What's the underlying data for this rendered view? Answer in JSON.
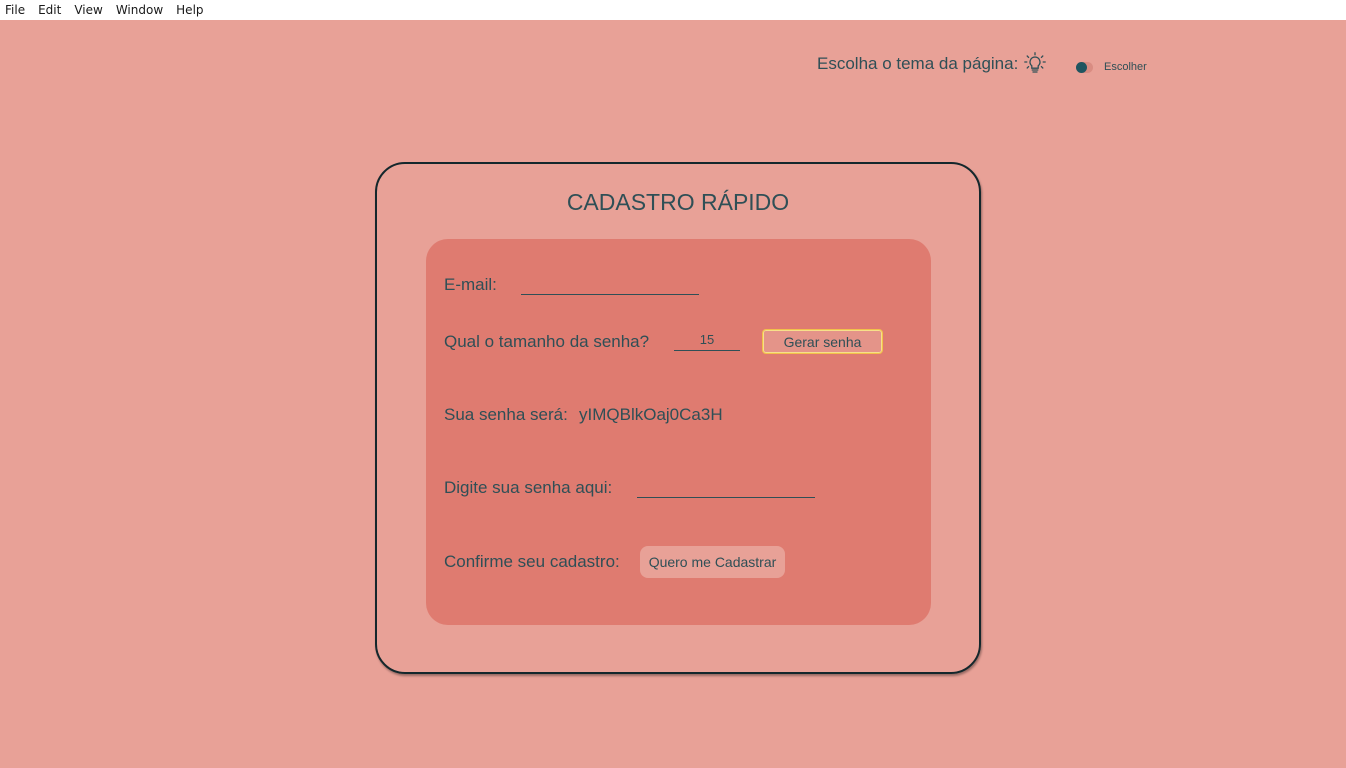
{
  "menu": [
    "File",
    "Edit",
    "View",
    "Window",
    "Help"
  ],
  "theme": {
    "label": "Escolha o tema da página:",
    "toggle_label": "Escolher",
    "bulb_icon": "lightbulb-icon"
  },
  "card": {
    "title": "CADASTRO RÁPIDO"
  },
  "form": {
    "email_label": "E-mail:",
    "email_value": "",
    "length_label": "Qual o tamanho da senha?",
    "length_value": "15",
    "generate_label": "Gerar senha",
    "result_label": "Sua senha será:",
    "generated_password": "yIMQBlkOaj0Ca3H",
    "password_label": "Digite sua senha aqui:",
    "password_value": "",
    "confirm_label": "Confirme seu cadastro:",
    "register_label": "Quero me Cadastrar"
  },
  "colors": {
    "background": "#e8a197",
    "panel": "#df7b70",
    "text": "#2f4f56",
    "focus_border": "#f2c04a"
  }
}
